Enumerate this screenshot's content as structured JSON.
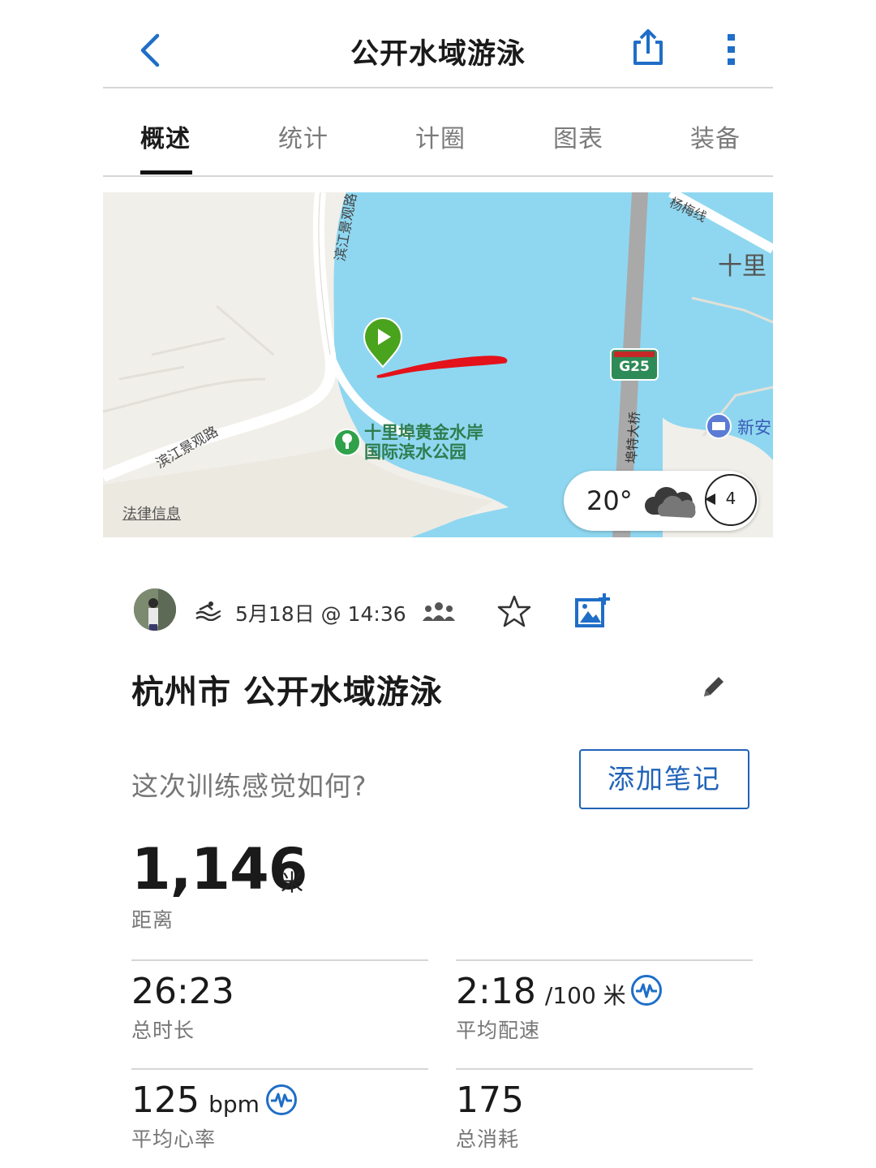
{
  "header": {
    "title": "公开水域游泳"
  },
  "tabs": [
    {
      "label": "概述",
      "active": true
    },
    {
      "label": "统计",
      "active": false
    },
    {
      "label": "计圈",
      "active": false
    },
    {
      "label": "图表",
      "active": false
    },
    {
      "label": "装备",
      "active": false
    }
  ],
  "map": {
    "labels": {
      "road_top": "滨江景观路",
      "road_left": "滨江景观路",
      "park_line1": "十里埠黄金水岸",
      "park_line2": "国际滨水公园",
      "place_right": "十里",
      "poi_right": "新安",
      "road_top_right": "杨梅线",
      "bridge": "埠特大桥",
      "highway": "G25",
      "legal": "法律信息"
    },
    "weather": {
      "temperature": "20°",
      "wind": "4"
    }
  },
  "activity": {
    "datetime": "5月18日 @ 14:36",
    "title": "杭州市 公开水域游泳",
    "feel_prompt": "这次训练感觉如何?",
    "add_note_label": "添加笔记"
  },
  "stats": {
    "distance": {
      "value": "1,146",
      "unit": "米",
      "label": "距离"
    },
    "duration": {
      "value": "26:23",
      "label": "总时长"
    },
    "pace": {
      "value": "2:18",
      "unit": "/100 米",
      "label": "平均配速"
    },
    "heart_rate": {
      "value": "125",
      "unit": "bpm",
      "label": "平均心率"
    },
    "calories": {
      "value": "175",
      "label": "总消耗"
    }
  },
  "colors": {
    "accent": "#1f6ec7",
    "water": "#8fd7f0",
    "track": "#e3121b",
    "start_marker": "#4aa31c"
  }
}
